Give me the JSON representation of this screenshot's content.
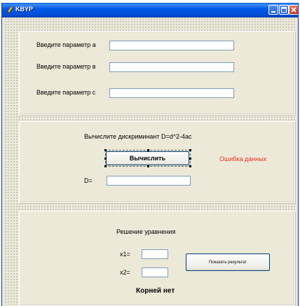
{
  "window": {
    "title": "KBYP"
  },
  "params": {
    "label_a": "Введите параметр а",
    "label_b": "Введите параметр в",
    "label_c": "Введите параметр с",
    "value_a": "",
    "value_b": "",
    "value_c": ""
  },
  "discriminant": {
    "heading": "Вычислите дискриминант D=d^2-4ac",
    "calc_button": "Вычислить",
    "error_text": "Ошибка данных",
    "d_label": "D=",
    "d_value": ""
  },
  "solution": {
    "heading": "Решение уравнения",
    "x1_label": "x1=",
    "x2_label": "x2=",
    "x1_value": "",
    "x2_value": "",
    "show_button": "Показать результат",
    "no_roots_text": "Корней нет"
  },
  "colors": {
    "error": "#e83020",
    "titlebar": "#0054e3",
    "face": "#ece9d8"
  },
  "icons": {
    "app": "pencil-app-icon",
    "minimize": "minimize-icon",
    "maximize": "maximize-icon",
    "close": "close-icon"
  }
}
